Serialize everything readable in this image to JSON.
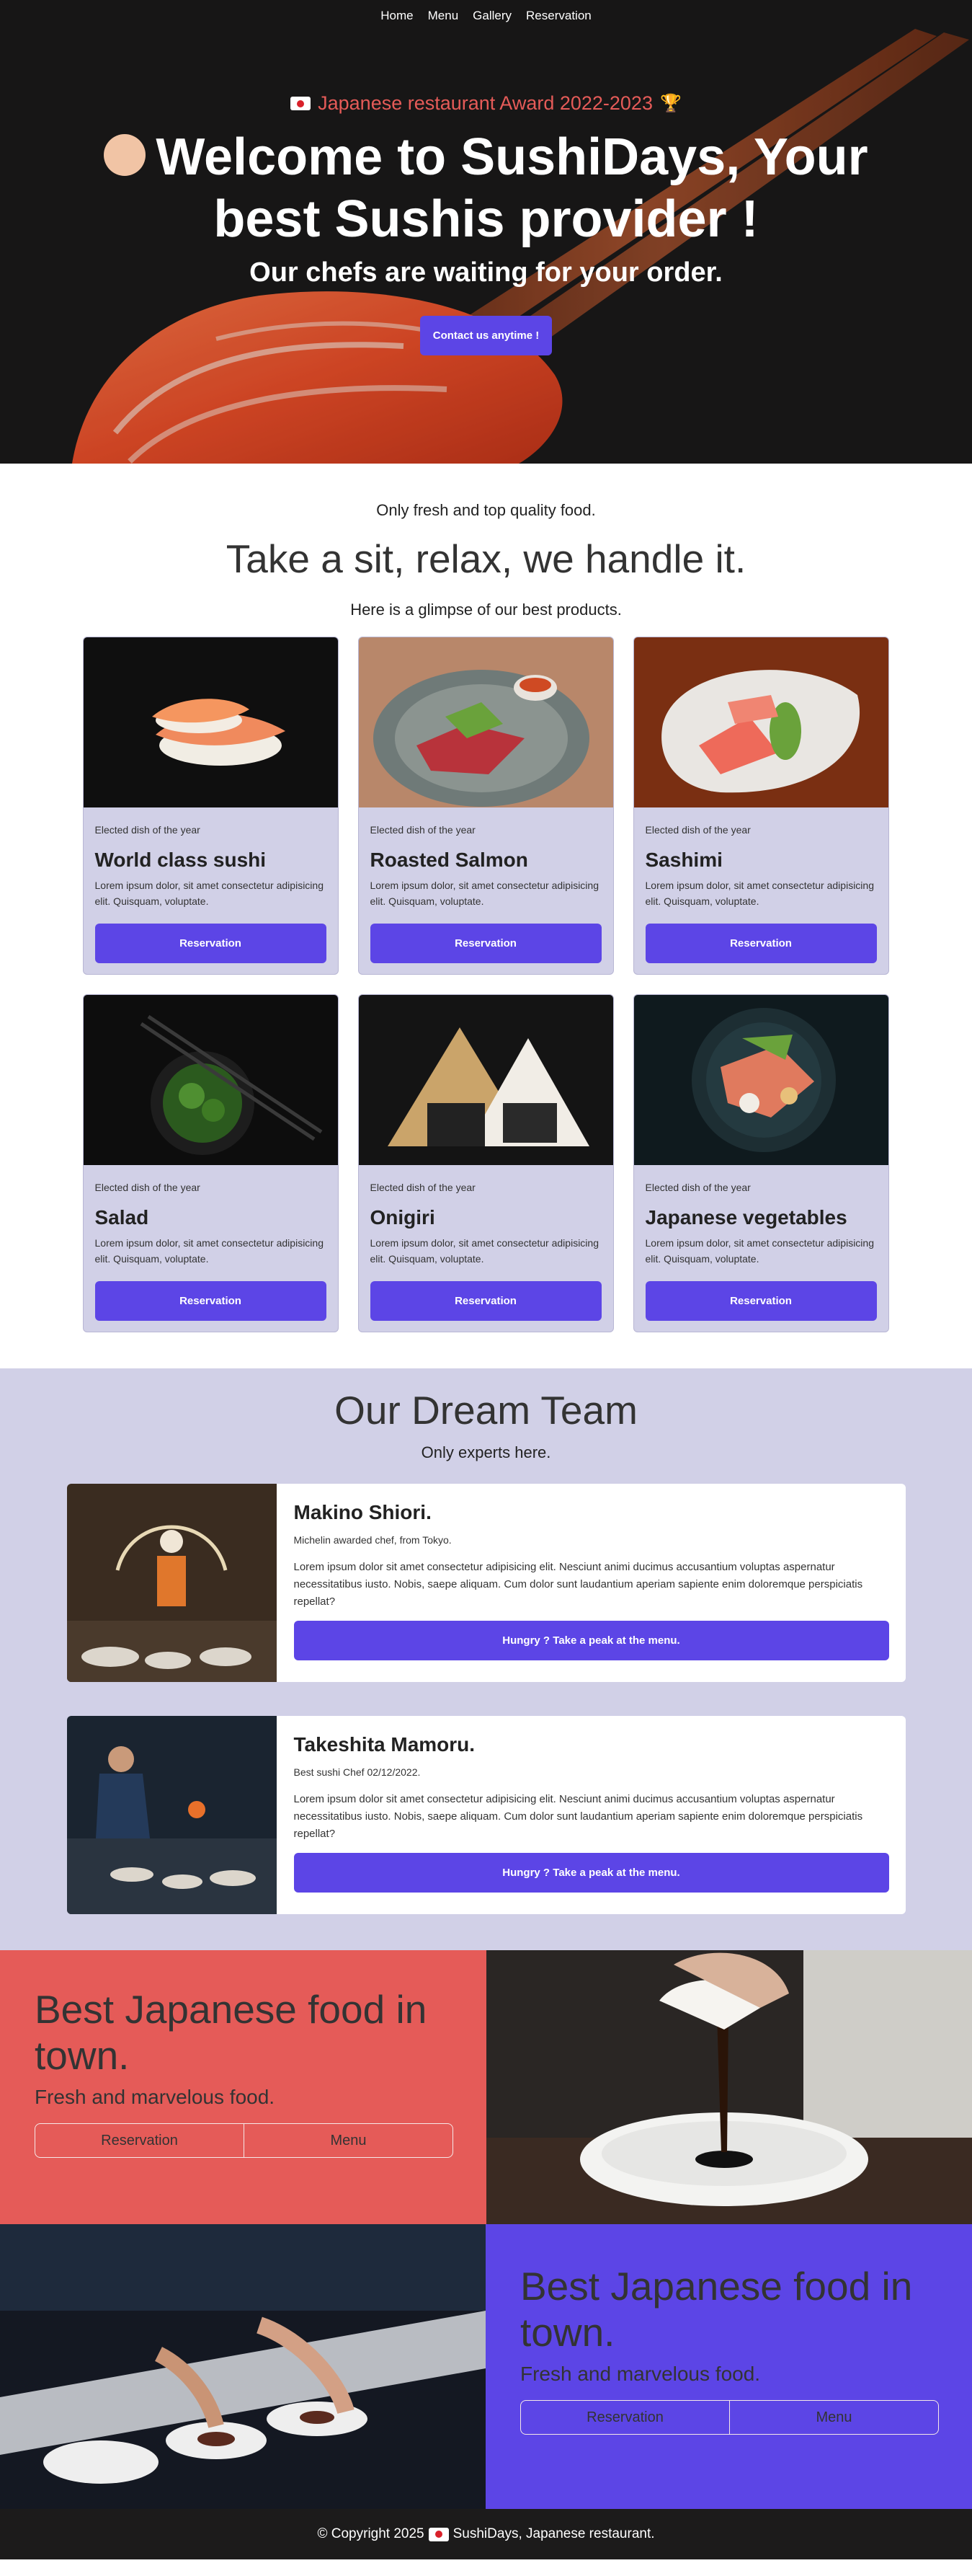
{
  "nav": {
    "items": [
      "Home",
      "Menu",
      "Gallery",
      "Reservation"
    ]
  },
  "hero": {
    "award": "Japanese restaurant Award 2022-2023",
    "title": "Welcome to SushiDays, Your best Sushis provider !",
    "subtitle": "Our chefs are waiting for your order.",
    "cta": "Contact us anytime !"
  },
  "products": {
    "kicker": "Only fresh and top quality food.",
    "title": "Take a sit, relax, we handle it.",
    "intro": "Here is a glimpse of our best products.",
    "cards": [
      {
        "kicker": "Elected dish of the year",
        "title": "World class sushi",
        "text": "Lorem ipsum dolor, sit amet consectetur adipisicing elit. Quisquam, voluptate.",
        "button": "Reservation"
      },
      {
        "kicker": "Elected dish of the year",
        "title": "Roasted Salmon",
        "text": "Lorem ipsum dolor, sit amet consectetur adipisicing elit. Quisquam, voluptate.",
        "button": "Reservation"
      },
      {
        "kicker": "Elected dish of the year",
        "title": "Sashimi",
        "text": "Lorem ipsum dolor, sit amet consectetur adipisicing elit. Quisquam, voluptate.",
        "button": "Reservation"
      },
      {
        "kicker": "Elected dish of the year",
        "title": "Salad",
        "text": "Lorem ipsum dolor, sit amet consectetur adipisicing elit. Quisquam, voluptate.",
        "button": "Reservation"
      },
      {
        "kicker": "Elected dish of the year",
        "title": "Onigiri",
        "text": "Lorem ipsum dolor, sit amet consectetur adipisicing elit. Quisquam, voluptate.",
        "button": "Reservation"
      },
      {
        "kicker": "Elected dish of the year",
        "title": "Japanese vegetables",
        "text": "Lorem ipsum dolor, sit amet consectetur adipisicing elit. Quisquam, voluptate.",
        "button": "Reservation"
      }
    ]
  },
  "team": {
    "title": "Our Dream Team",
    "subtitle": "Only experts here.",
    "members": [
      {
        "name": "Makino Shiori.",
        "role": "Michelin awarded chef, from Tokyo.",
        "text": "Lorem ipsum dolor sit amet consectetur adipisicing elit. Nesciunt animi ducimus accusantium voluptas aspernatur necessitatibus iusto. Nobis, saepe aliquam. Cum dolor sunt laudantium aperiam sapiente enim doloremque perspiciatis repellat?",
        "button": "Hungry ? Take a peak at the menu."
      },
      {
        "name": "Takeshita Mamoru.",
        "role": "Best sushi Chef 02/12/2022.",
        "text": "Lorem ipsum dolor sit amet consectetur adipisicing elit. Nesciunt animi ducimus accusantium voluptas aspernatur necessitatibus iusto. Nobis, saepe aliquam. Cum dolor sunt laudantium aperiam sapiente enim doloremque perspiciatis repellat?",
        "button": "Hungry ? Take a peak at the menu."
      }
    ]
  },
  "promos": [
    {
      "title": "Best Japanese food in town.",
      "subtitle": "Fresh and marvelous food.",
      "buttons": [
        "Reservation",
        "Menu"
      ]
    },
    {
      "title": "Best Japanese food in town.",
      "subtitle": "Fresh and marvelous food.",
      "buttons": [
        "Reservation",
        "Menu"
      ]
    }
  ],
  "footer": {
    "text_before": "© Copyright 2025",
    "text_after": "SushiDays, Japanese restaurant."
  },
  "colors": {
    "accent": "#5c45e6",
    "coral": "#e55b58",
    "lavender": "#d1d0e7",
    "dark": "#1c1b1b"
  },
  "icons": [
    "japan-flag-icon",
    "trophy-icon",
    "waving-hand-icon"
  ]
}
